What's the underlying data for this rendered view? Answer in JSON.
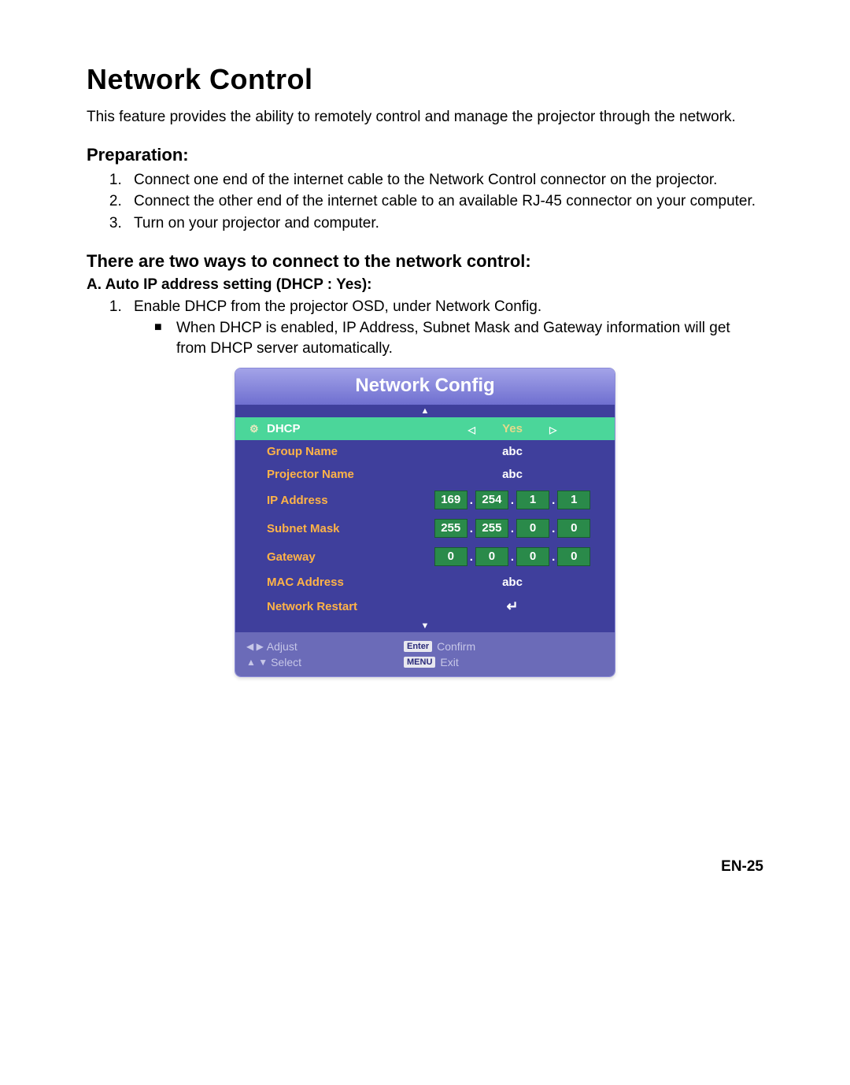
{
  "title": "Network Control",
  "intro": "This feature provides the ability to remotely control and manage the projector through the network.",
  "prep_heading": "Preparation:",
  "prep_steps": [
    "Connect one end of the internet cable to the Network Control connector on the projector.",
    "Connect the other end of the internet cable to an available RJ-45 connector on your computer.",
    "Turn on your projector and computer."
  ],
  "ways_heading": "There are two ways to connect to the network control:",
  "method_a": "A. Auto IP address setting (DHCP : Yes):",
  "step1": "Enable DHCP from the projector OSD, under Network Config.",
  "bullet1": "When DHCP is enabled, IP Address, Subnet Mask and Gateway information will get from DHCP server automatically.",
  "osd": {
    "title": "Network Config",
    "dhcp_label": "DHCP",
    "dhcp_value": "Yes",
    "group_name_label": "Group Name",
    "group_name_value": "abc",
    "projector_name_label": "Projector Name",
    "projector_name_value": "abc",
    "ip_label": "IP Address",
    "ip": [
      "169",
      "254",
      "1",
      "1"
    ],
    "subnet_label": "Subnet Mask",
    "subnet": [
      "255",
      "255",
      "0",
      "0"
    ],
    "gateway_label": "Gateway",
    "gateway": [
      "0",
      "0",
      "0",
      "0"
    ],
    "mac_label": "MAC Address",
    "mac_value": "abc",
    "restart_label": "Network Restart",
    "foot_adjust": "Adjust",
    "foot_select": "Select",
    "foot_enter": "Enter",
    "foot_confirm": "Confirm",
    "foot_menu": "MENU",
    "foot_exit": "Exit"
  },
  "page_num": "EN-25"
}
